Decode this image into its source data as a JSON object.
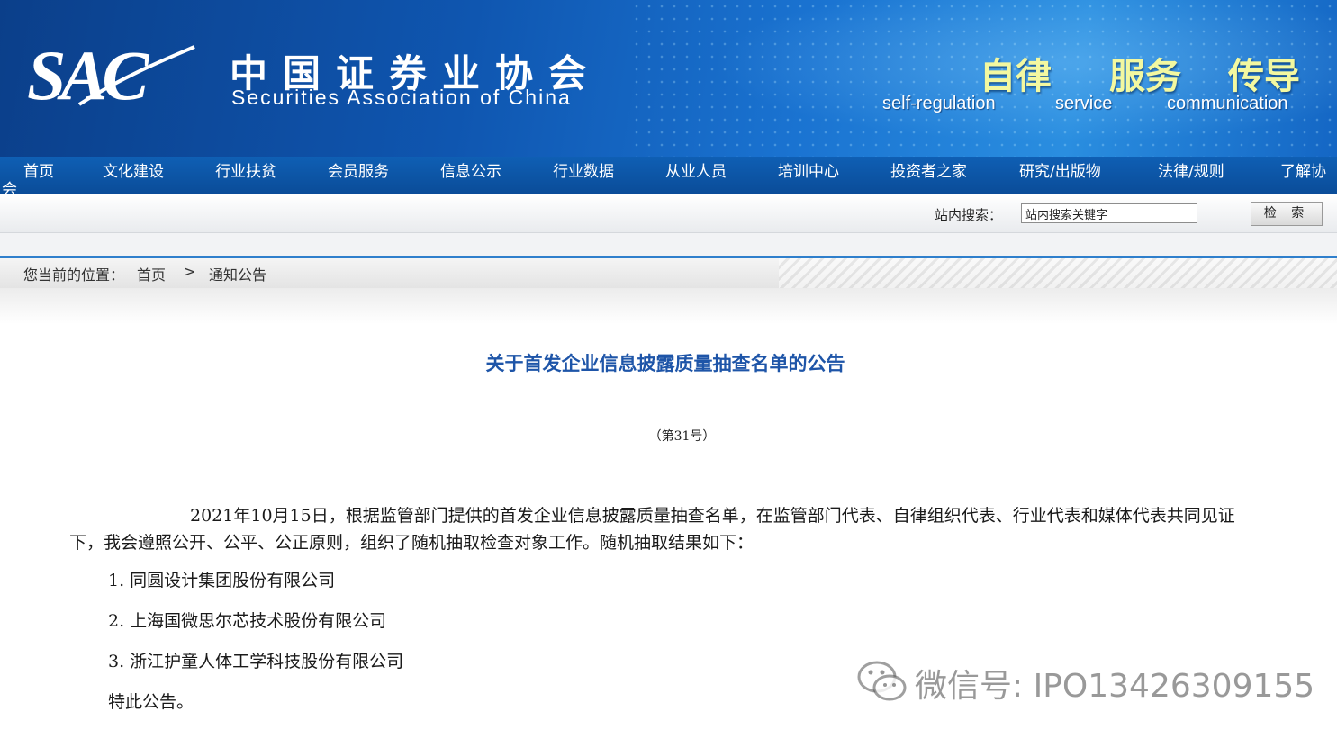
{
  "header": {
    "logo_text": "SAC",
    "org_name_cn": "中国证券业协会",
    "org_name_en": "Securities Association of China",
    "slogans": [
      {
        "cn": "自律",
        "en": "self-regulation"
      },
      {
        "cn": "服务",
        "en": "service"
      },
      {
        "cn": "传导",
        "en": "communication"
      }
    ]
  },
  "nav": {
    "items": [
      "首页",
      "文化建设",
      "行业扶贫",
      "会员服务",
      "信息公示",
      "行业数据",
      "从业人员",
      "培训中心",
      "投资者之家",
      "研究/出版物",
      "法律/规则",
      "了解协"
    ],
    "wrap_text": "会"
  },
  "search": {
    "label": "站内搜索：",
    "value": "站内搜索关键字",
    "button": "检 索"
  },
  "breadcrumb": {
    "prefix": "您当前的位置：",
    "home": "首页",
    "separator": ">",
    "current": "通知公告"
  },
  "article": {
    "title": "关于首发企业信息披露质量抽查名单的公告",
    "number": "（第31号）",
    "paragraph": "2021年10月15日，根据监管部门提供的首发企业信息披露质量抽查名单，在监管部门代表、自律组织代表、行业代表和媒体代表共同见证下，我会遵照公开、公平、公正原则，组织了随机抽取检查对象工作。随机抽取结果如下：",
    "list": [
      "1.  同圆设计集团股份有限公司",
      "2.  上海国微思尔芯技术股份有限公司",
      "3.  浙江护童人体工学科技股份有限公司"
    ],
    "closing": "特此公告。"
  },
  "watermark": {
    "text": "微信号: IPO13426309155",
    "icon": "wechat-icon"
  },
  "colors": {
    "banner": "#0f56b0",
    "nav": "#0a4c98",
    "title": "#1e55a8",
    "slogan": "#f3f8a0"
  }
}
